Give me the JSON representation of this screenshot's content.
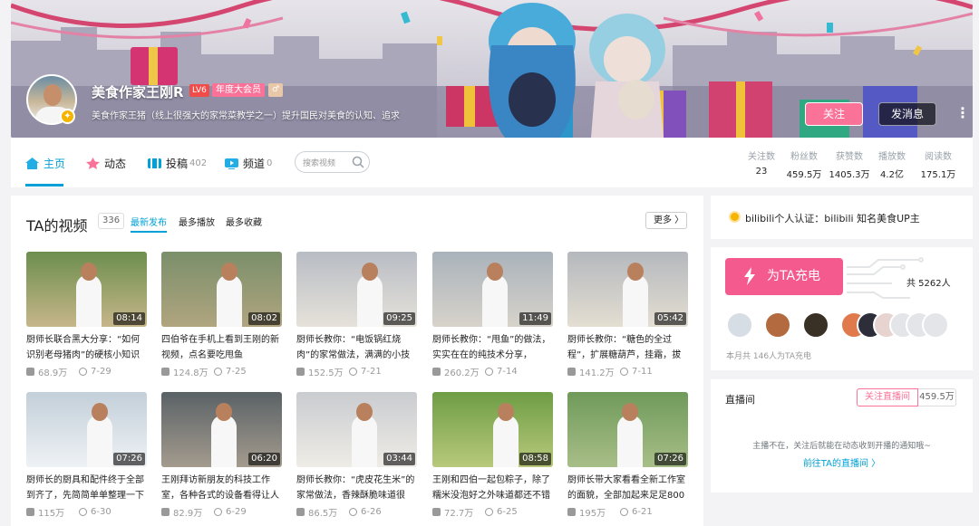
{
  "profile": {
    "name": "美食作家王刚R",
    "level": "LV6",
    "vip": "年度大会员",
    "sex_icon": "♂",
    "signature": "美食作家王猪（线上很强大的家常菜教学之一）提升国民对美食的认知、追求",
    "follow_label": "关注",
    "message_label": "发消息",
    "more_label": "⋮",
    "badge": "✦"
  },
  "nav": {
    "items": [
      {
        "label": "主页",
        "count": ""
      },
      {
        "label": "动态",
        "count": ""
      },
      {
        "label": "投稿",
        "count": "402"
      },
      {
        "label": "频道",
        "count": "0"
      }
    ],
    "search_placeholder": "搜索视频"
  },
  "stats": [
    {
      "label": "关注数",
      "value": "23"
    },
    {
      "label": "粉丝数",
      "value": "459.5万"
    },
    {
      "label": "获赞数",
      "value": "1405.3万"
    },
    {
      "label": "播放数",
      "value": "4.2亿"
    },
    {
      "label": "阅读数",
      "value": "175.1万"
    }
  ],
  "videos_section": {
    "title": "TA的视频",
    "count": "336",
    "sort": [
      "最新发布",
      "最多播放",
      "最多收藏"
    ],
    "more_label": "更多 〉"
  },
  "videos": [
    {
      "title": "厨师长联合黑大分享：“如何识别老母猪肉”的硬核小知识",
      "duration": "08:14",
      "plays": "68.9万",
      "date": "7-29"
    },
    {
      "title": "四伯爷在手机上看到王刚的新视频，点名要吃甩鱼",
      "duration": "08:02",
      "plays": "124.8万",
      "date": "7-25"
    },
    {
      "title": "厨师长教你：“电饭锅红烧肉”的家常做法，满满的小技",
      "duration": "09:25",
      "plays": "152.5万",
      "date": "7-21"
    },
    {
      "title": "厨师长教你：“甩鱼”的做法，实实在在的纯技术分享，",
      "duration": "11:49",
      "plays": "260.2万",
      "date": "7-14"
    },
    {
      "title": "厨师长教你：“糖色的全过程”，扩展糖葫芦，挂霜，拔",
      "duration": "05:42",
      "plays": "141.2万",
      "date": "7-11"
    },
    {
      "title": "厨师长的厨具和配件终于全部到齐了，先简简单单整理一下",
      "duration": "07:26",
      "plays": "115万",
      "date": "6-30"
    },
    {
      "title": "王刚拜访新朋友的科技工作室，各种各式的设备看得让人",
      "duration": "06:20",
      "plays": "82.9万",
      "date": "6-29"
    },
    {
      "title": "厨师长教你：“虎皮花生米”的家常做法，香辣酥脆味道很",
      "duration": "03:44",
      "plays": "86.5万",
      "date": "6-26"
    },
    {
      "title": "王刚和四伯一起包粽子，除了糯米没泡好之外味道都还不错",
      "duration": "08:58",
      "plays": "72.7万",
      "date": "6-25"
    },
    {
      "title": "厨师长带大家看看全新工作室的面貌，全部加起来足足800",
      "duration": "07:26",
      "plays": "195万",
      "date": "6-21"
    }
  ],
  "certification": {
    "text": "bilibili个人认证：bilibili 知名美食UP主"
  },
  "charge": {
    "button_label": "为TA充电",
    "total": "共 5262人",
    "note": "本月共 146人为TA充电"
  },
  "live": {
    "title": "直播间",
    "follow_label": "关注直播间",
    "count": "459.5万",
    "info": "主播不在，关注后就能在动态收到开播的通知哦~",
    "link": "前往TA的直播间 〉"
  },
  "colors": {
    "accent": "#00a1d6",
    "pink": "#fb7299",
    "charge": "#f45a8d"
  }
}
